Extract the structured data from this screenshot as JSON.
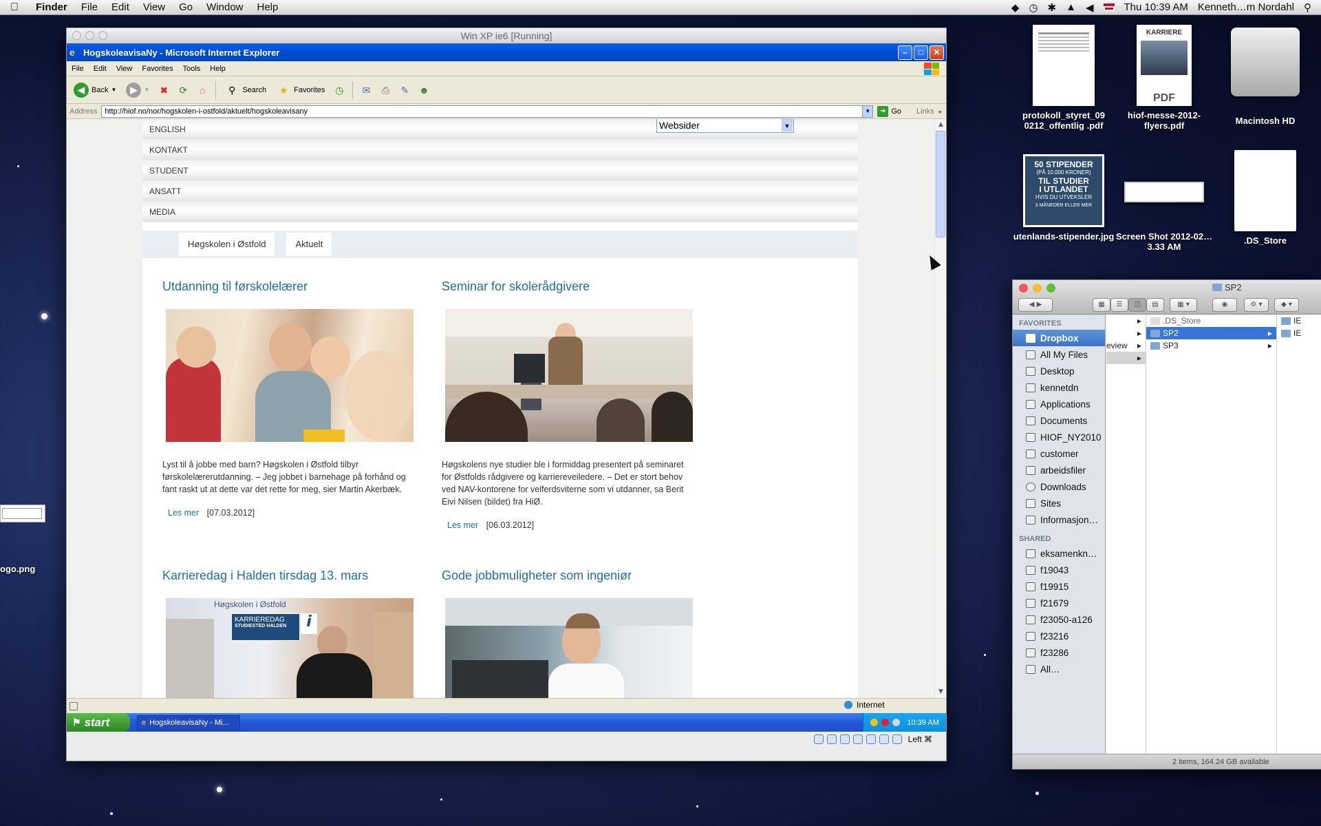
{
  "menubar": {
    "app_name": "Finder",
    "items": [
      "File",
      "Edit",
      "View",
      "Go",
      "Window",
      "Help"
    ],
    "clock": "Thu 10:39 AM",
    "user": "Kenneth…m Nordahl"
  },
  "desktop_icons": [
    {
      "label": "protokoll_styret_09 0212_offentlig .pdf"
    },
    {
      "label": "hiof-messe-2012-flyers.pdf",
      "thumb_text": "PDF",
      "thumb_header": "KARRIERE"
    },
    {
      "label": "Macintosh HD"
    },
    {
      "label": "utenlands-stipender.jpg",
      "thumb_lines": [
        "50 STIPENDER",
        "(PÅ 10.000 KRONER)",
        "TIL STUDIER",
        "I UTLANDET",
        "HVIS DU UTVEKSLER",
        "3 MÅNEDER ELLER MER"
      ]
    },
    {
      "label": "Screen Shot 2012-02…3.33 AM"
    },
    {
      "label": ".DS_Store"
    }
  ],
  "left_edge_label": "ogo.png",
  "vm_window": {
    "title": "Win XP ie6 [Running]",
    "status_text": "Left ⌘"
  },
  "ie": {
    "title": "HogskoleavisaNy - Microsoft Internet Explorer",
    "menu": [
      "File",
      "Edit",
      "View",
      "Favorites",
      "Tools",
      "Help"
    ],
    "toolbar": {
      "back": "Back",
      "search": "Search",
      "favorites": "Favorites"
    },
    "address_label": "Address",
    "address_value": "http://hiof.no/nor/hogskolen-i-ostfold/aktuelt/hogskoleavisany",
    "go_label": "Go",
    "links_label": "Links",
    "status_zone": "Internet"
  },
  "page": {
    "nav": [
      "ENGLISH",
      "KONTAKT",
      "STUDENT",
      "ANSATT",
      "MEDIA"
    ],
    "websider_select": "Websider",
    "breadcrumbs": [
      "Høgskolen i Østfold",
      "Aktuelt"
    ],
    "articles": [
      {
        "title": "Utdanning til førskolelærer",
        "body": "Lyst til å jobbe med barn? Høgskolen i Østfold tilbyr førskolelærerutdanning. – Jeg jobbet i barnehage på forhånd og fant raskt ut at dette var det rette for meg, sier Martin Akerbæk.",
        "more": "Les mer",
        "date": "[07.03.2012]"
      },
      {
        "title": "Seminar for skolerådgivere",
        "body": "Høgskolens nye studier ble i formiddag presentert på seminaret for Østfolds rådgivere og karriereveiledere. – Det er stort behov ved NAV-kontorene for velferdsviterne som vi utdanner, sa Berit Eivi Nilsen (bildet) fra HiØ.",
        "more": "Les mer",
        "date": "[06.03.2012]"
      },
      {
        "title": "Karrieredag i Halden tirsdag 13. mars",
        "img_badge_1": "KARRIEREDAG",
        "img_badge_2": "STUDIESTED HALDEN",
        "img_logo": "Høgskolen i Østfold"
      },
      {
        "title": "Gode jobbmuligheter som ingeniør"
      }
    ]
  },
  "taskbar": {
    "start": "start",
    "task": "HogskoleavisaNy - Mi...",
    "clock": "10:39 AM"
  },
  "finder": {
    "title": "SP2",
    "favorites_header": "FAVORITES",
    "favorites": [
      "Dropbox",
      "All My Files",
      "Desktop",
      "kennetdn",
      "Applications",
      "Documents",
      "HIOF_NY2010",
      "customer",
      "arbeidsfiler",
      "Downloads",
      "Sites",
      "Informasjon…"
    ],
    "shared_header": "SHARED",
    "shared": [
      "eksamenkn…",
      "f19043",
      "f19915",
      "f21679",
      "f23050-a126",
      "f23216",
      "f23286",
      "All…"
    ],
    "col1_partial": "eview",
    "col2": [
      ".DS_Store",
      "SP2",
      "SP3"
    ],
    "col3_partial": [
      "IE",
      "IE"
    ],
    "status": "2 items, 164.24 GB available"
  }
}
